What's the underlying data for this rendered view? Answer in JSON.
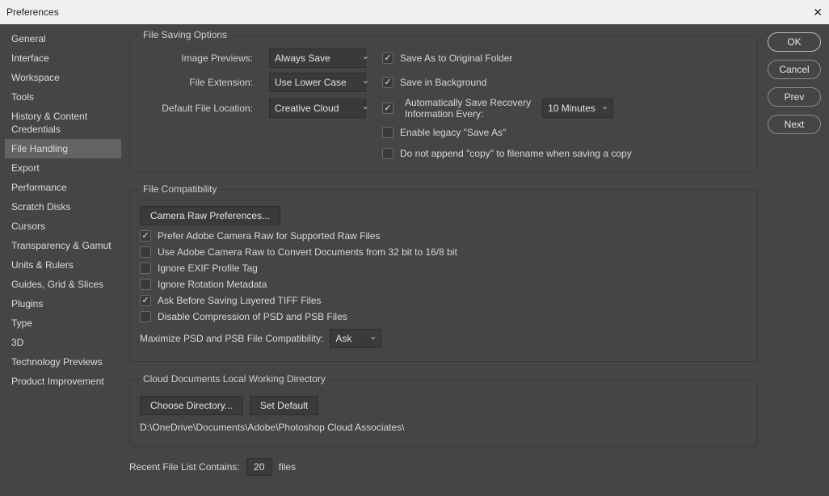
{
  "title": "Preferences",
  "buttons": {
    "ok": "OK",
    "cancel": "Cancel",
    "prev": "Prev",
    "next": "Next"
  },
  "sidebar": {
    "items": [
      "General",
      "Interface",
      "Workspace",
      "Tools",
      "History & Content Credentials",
      "File Handling",
      "Export",
      "Performance",
      "Scratch Disks",
      "Cursors",
      "Transparency & Gamut",
      "Units & Rulers",
      "Guides, Grid & Slices",
      "Plugins",
      "Type",
      "3D",
      "Technology Previews",
      "Product Improvement"
    ],
    "selectedIndex": 5
  },
  "fileSaving": {
    "legend": "File Saving Options",
    "imagePreviewsLabel": "Image Previews:",
    "imagePreviewsValue": "Always Save",
    "fileExtensionLabel": "File Extension:",
    "fileExtensionValue": "Use Lower Case",
    "defaultLocationLabel": "Default File Location:",
    "defaultLocationValue": "Creative Cloud",
    "saveAsOriginal": "Save As to Original Folder",
    "saveInBackground": "Save in Background",
    "autoSaveLabel1": "Automatically Save Recovery",
    "autoSaveLabel2": "Information Every:",
    "autoSaveInterval": "10 Minutes",
    "enableLegacy": "Enable legacy \"Save As\"",
    "doNotAppendCopy": "Do not append \"copy\" to filename when saving a copy"
  },
  "fileCompat": {
    "legend": "File Compatibility",
    "cameraRawBtn": "Camera Raw Preferences...",
    "preferACR": "Prefer Adobe Camera Raw for Supported Raw Files",
    "useACR32to16": "Use Adobe Camera Raw to Convert Documents from 32 bit to 16/8 bit",
    "ignoreEXIF": "Ignore EXIF Profile Tag",
    "ignoreRotation": "Ignore Rotation Metadata",
    "askTIFF": "Ask Before Saving Layered TIFF Files",
    "disableCompression": "Disable Compression of PSD and PSB Files",
    "maximizeLabel": "Maximize PSD and PSB File Compatibility:",
    "maximizeValue": "Ask"
  },
  "cloudDir": {
    "legend": "Cloud Documents Local Working Directory",
    "chooseBtn": "Choose Directory...",
    "setDefaultBtn": "Set Default",
    "path": "D:\\OneDrive\\Documents\\Adobe\\Photoshop Cloud Associates\\"
  },
  "recent": {
    "label": "Recent File List Contains:",
    "value": "20",
    "suffix": "files"
  }
}
